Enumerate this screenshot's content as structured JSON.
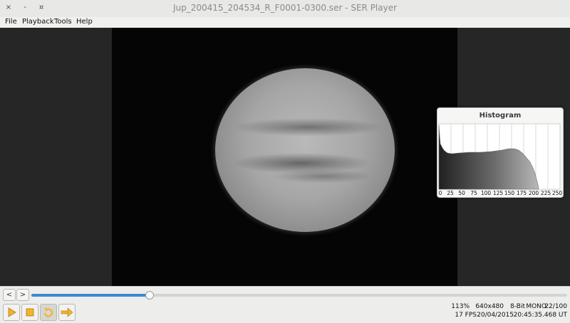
{
  "window": {
    "title": "Jup_200415_204534_R_F0001-0300.ser - SER Player",
    "close_glyph": "×",
    "minimize_glyph": "-",
    "maximize_glyph": "¤"
  },
  "menu": [
    "File",
    "Playback",
    "Tools",
    "Help"
  ],
  "histogram": {
    "title": "Histogram",
    "tick_labels": [
      "0",
      "25",
      "50",
      "75",
      "100",
      "125",
      "150",
      "175",
      "200",
      "225",
      "250"
    ]
  },
  "transport": {
    "prev_label": "<",
    "next_label": ">",
    "frame_progress": 0.22,
    "buttons": [
      "play-icon",
      "stop-icon",
      "repeat-icon",
      "forward-icon"
    ],
    "accent_color": "#3b8ad3",
    "icon_color": "#f4b32a"
  },
  "status": {
    "zoom": "113%",
    "resolution": "640x480",
    "bit_depth": "8-Bit",
    "color_mode": "MONO",
    "frame_counter": "22/100",
    "fps": "17 FPS",
    "date": "20/04/2015",
    "time": "20:45:35.468 UT"
  }
}
